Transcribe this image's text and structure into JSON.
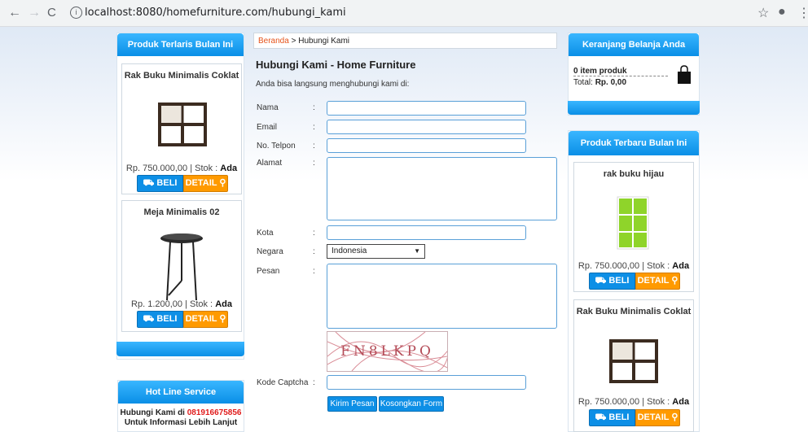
{
  "browser": {
    "url": "localhost:8080/homefurniture.com/hubungi_kami",
    "back": "←",
    "forward": "→",
    "reload": "C",
    "star": "☆",
    "account": "●",
    "menu": "⋮"
  },
  "left_panel": {
    "title": "Produk Terlaris Bulan Ini",
    "products": [
      {
        "name": "Rak Buku Minimalis Coklat",
        "price_prefix": "Rp. 750.000,00 | Stok : ",
        "stock": "Ada",
        "buy": "BELI",
        "detail": "DETAIL"
      },
      {
        "name": "Meja Minimalis 02",
        "price_prefix": "Rp. 1.200,00 | Stok : ",
        "stock": "Ada",
        "buy": "BELI",
        "detail": "DETAIL"
      }
    ]
  },
  "hotline": {
    "title": "Hot Line Service",
    "line1": "Hubungi Kami di ",
    "phone": "081916675856",
    "line2": "Untuk Informasi Lebih Lanjut"
  },
  "breadcrumb": {
    "home": "Beranda",
    "sep": " > ",
    "current": "Hubungi Kami"
  },
  "contact": {
    "heading": "Hubungi Kami - Home Furniture",
    "intro": "Anda bisa langsung menghubungi kami di:",
    "labels": {
      "nama": "Nama",
      "email": "Email",
      "telpon": "No. Telpon",
      "alamat": "Alamat",
      "kota": "Kota",
      "negara": "Negara",
      "pesan": "Pesan",
      "captcha": "Kode Captcha"
    },
    "colon": ":",
    "country_selected": "Indonesia",
    "captcha_text": "FN8LKPQ",
    "submit": "Kirim Pesan",
    "reset": "Kosongkan Form"
  },
  "cart": {
    "title": "Keranjang Belanja Anda",
    "items": "0 item produk",
    "total_label": "Total: ",
    "total_value": "Rp. 0,00"
  },
  "right_panel": {
    "title": "Produk Terbaru Bulan Ini",
    "products": [
      {
        "name": "rak buku hijau",
        "price_prefix": "Rp. 750.000,00 | Stok : ",
        "stock": "Ada",
        "buy": "BELI",
        "detail": "DETAIL"
      },
      {
        "name": "Rak Buku Minimalis Coklat",
        "price_prefix": "Rp. 750.000,00 | Stok : ",
        "stock": "Ada",
        "buy": "BELI",
        "detail": "DETAIL"
      }
    ]
  },
  "icons": {
    "cart": "cart-icon",
    "search": "search-icon",
    "bag": "shopping-bag-icon"
  }
}
